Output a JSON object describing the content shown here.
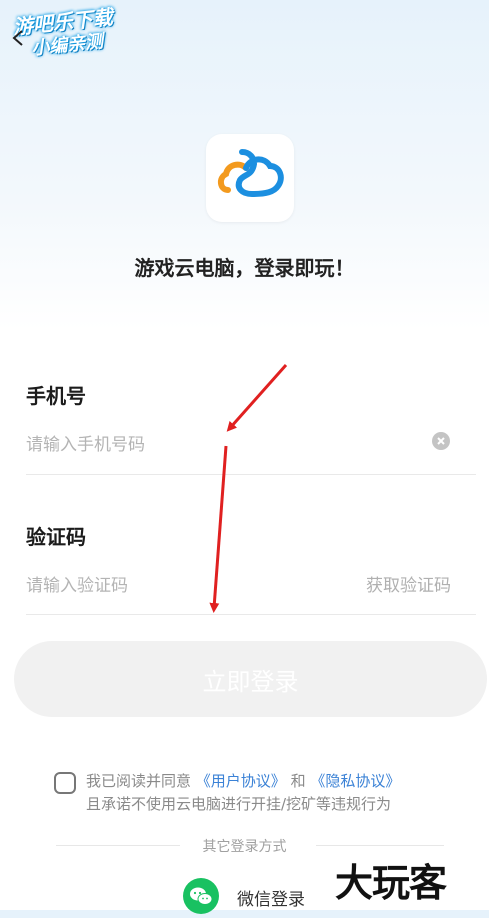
{
  "watermark": {
    "line1": "游吧乐下载",
    "line2": "小编亲测"
  },
  "slogan": "游戏云电脑，登录即玩！",
  "phone": {
    "label": "手机号",
    "placeholder": "请输入手机号码"
  },
  "code": {
    "label": "验证码",
    "placeholder": "请输入验证码",
    "get_code": "获取验证码"
  },
  "login_button": "立即登录",
  "agreement": {
    "prefix": "我已阅读并同意",
    "user_agreement": "《用户协议》",
    "and": "和",
    "privacy": "《隐私协议》",
    "line2": "且承诺不使用云电脑进行开挂/挖矿等违规行为"
  },
  "other_login": "其它登录方式",
  "wechat_login": "微信登录",
  "brand_watermark": "大玩客",
  "colors": {
    "accent_blue": "#3b82d6",
    "logo_orange": "#f39a1e",
    "logo_blue": "#1c8fe0",
    "wechat_green": "#19c161",
    "arrow_red": "#e02020"
  }
}
